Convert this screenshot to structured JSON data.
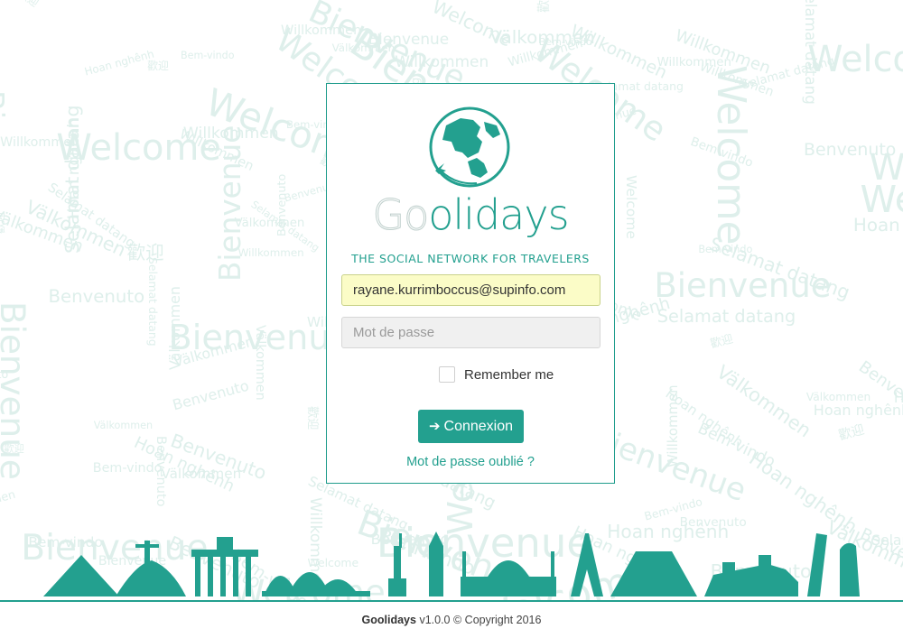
{
  "brand": {
    "name_prefix": "Go",
    "name_suffix": "olidays",
    "tagline": "THE SOCIAL NETWORK FOR TRAVELERS"
  },
  "form": {
    "email_value": "rayane.kurrimboccus@supinfo.com",
    "password_placeholder": "Mot de passe",
    "remember_label": "Remember me",
    "login_label": "Connexion",
    "forgot_label": "Mot de passe oublié ?"
  },
  "footer": {
    "app_name": "Goolidays",
    "version_text": "v1.0.0 © Copyright 2016"
  },
  "background_words": [
    "Welcome",
    "Bienvenue",
    "Bem-vindo",
    "Willkommen",
    "Benvenuto",
    "Välkommen",
    "Hoan nghênh",
    "Selamat datang",
    "歡迎"
  ],
  "colors": {
    "accent": "#23a08f",
    "background_text": "#deefeb",
    "email_highlight": "#fbfcc7"
  },
  "icons": {
    "logo": "globe-plane-icon",
    "login": "sign-in-icon"
  }
}
